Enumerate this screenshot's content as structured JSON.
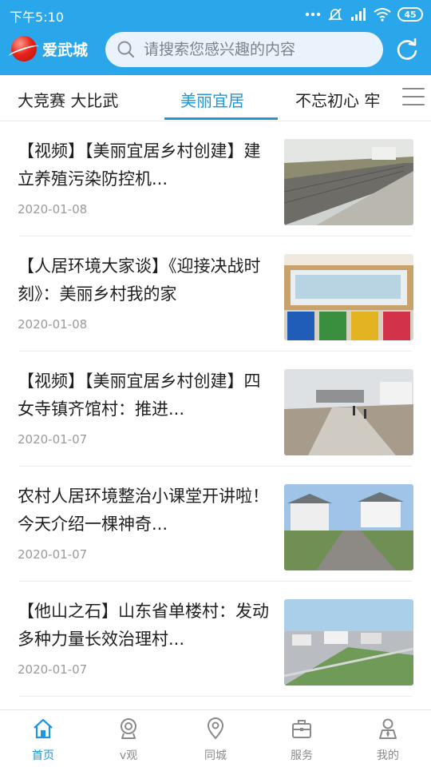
{
  "status_bar": {
    "time": "下午5:10",
    "battery": "45"
  },
  "header": {
    "app_name": "爱武城",
    "search_placeholder": "请搜索您感兴趣的内容"
  },
  "tabs": [
    {
      "label": "大竞赛  大比武",
      "active": false
    },
    {
      "label": "美丽宜居",
      "active": true
    },
    {
      "label": "不忘初心  牢",
      "active": false
    }
  ],
  "news": [
    {
      "title": "【视频】【美丽宜居乡村创建】建立养殖污染防控机...",
      "date": "2020-01-08"
    },
    {
      "title": "【人居环境大家谈】《迎接决战时刻》：美丽乡村我的家",
      "date": "2020-01-08"
    },
    {
      "title": "【视频】【美丽宜居乡村创建】四女寺镇齐馆村：推进...",
      "date": "2020-01-07"
    },
    {
      "title": "农村人居环境整治小课堂开讲啦！今天介绍一棵神奇...",
      "date": "2020-01-07"
    },
    {
      "title": "【他山之石】山东省单楼村：发动多种力量长效治理村...",
      "date": "2020-01-07"
    }
  ],
  "bottom_nav": [
    {
      "label": "首页",
      "icon": "home-icon",
      "active": true
    },
    {
      "label": "v观",
      "icon": "camera-icon",
      "active": false
    },
    {
      "label": "同城",
      "icon": "location-icon",
      "active": false
    },
    {
      "label": "服务",
      "icon": "briefcase-icon",
      "active": false
    },
    {
      "label": "我的",
      "icon": "user-icon",
      "active": false
    }
  ],
  "colors": {
    "header_bg": "#2aa6ea",
    "accent": "#2196d8",
    "inactive": "#8a8a8a"
  }
}
